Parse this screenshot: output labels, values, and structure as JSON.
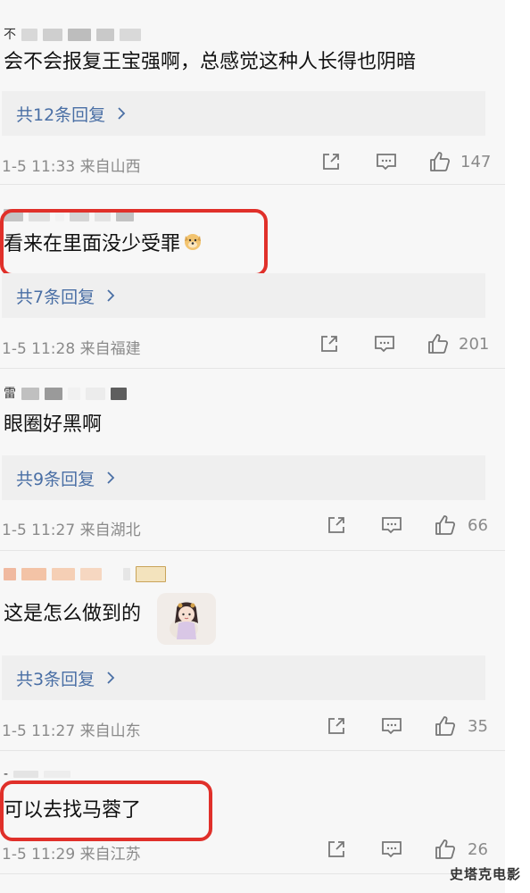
{
  "comments": [
    {
      "text": "会不会报复王宝强啊，总感觉这种人长得也阴暗",
      "replies_label": "共12条回复",
      "time": "1-5 11:33",
      "location": "来自山西",
      "likes": "147"
    },
    {
      "text": "看来在里面没少受罪",
      "replies_label": "共7条回复",
      "time": "1-5 11:28",
      "location": "来自福建",
      "likes": "201",
      "highlighted": true
    },
    {
      "text": "眼圈好黑啊",
      "replies_label": "共9条回复",
      "time": "1-5 11:27",
      "location": "来自湖北",
      "likes": "66"
    },
    {
      "text": "这是怎么做到的",
      "replies_label": "共3条回复",
      "time": "1-5 11:27",
      "location": "来自山东",
      "likes": "35"
    },
    {
      "text": "可以去找马蓉了",
      "time": "1-5 11:29",
      "location": "来自江苏",
      "likes": "26",
      "highlighted": true
    }
  ],
  "icons": {
    "share": "share-icon",
    "comment": "comment-icon",
    "like": "thumbs-up-icon",
    "chevron": "chevron-right-icon"
  },
  "watermark": "史塔克电影",
  "colors": {
    "reply_link": "#4a6fa5",
    "highlight": "#e0302a",
    "meta": "#8a8a8a"
  }
}
